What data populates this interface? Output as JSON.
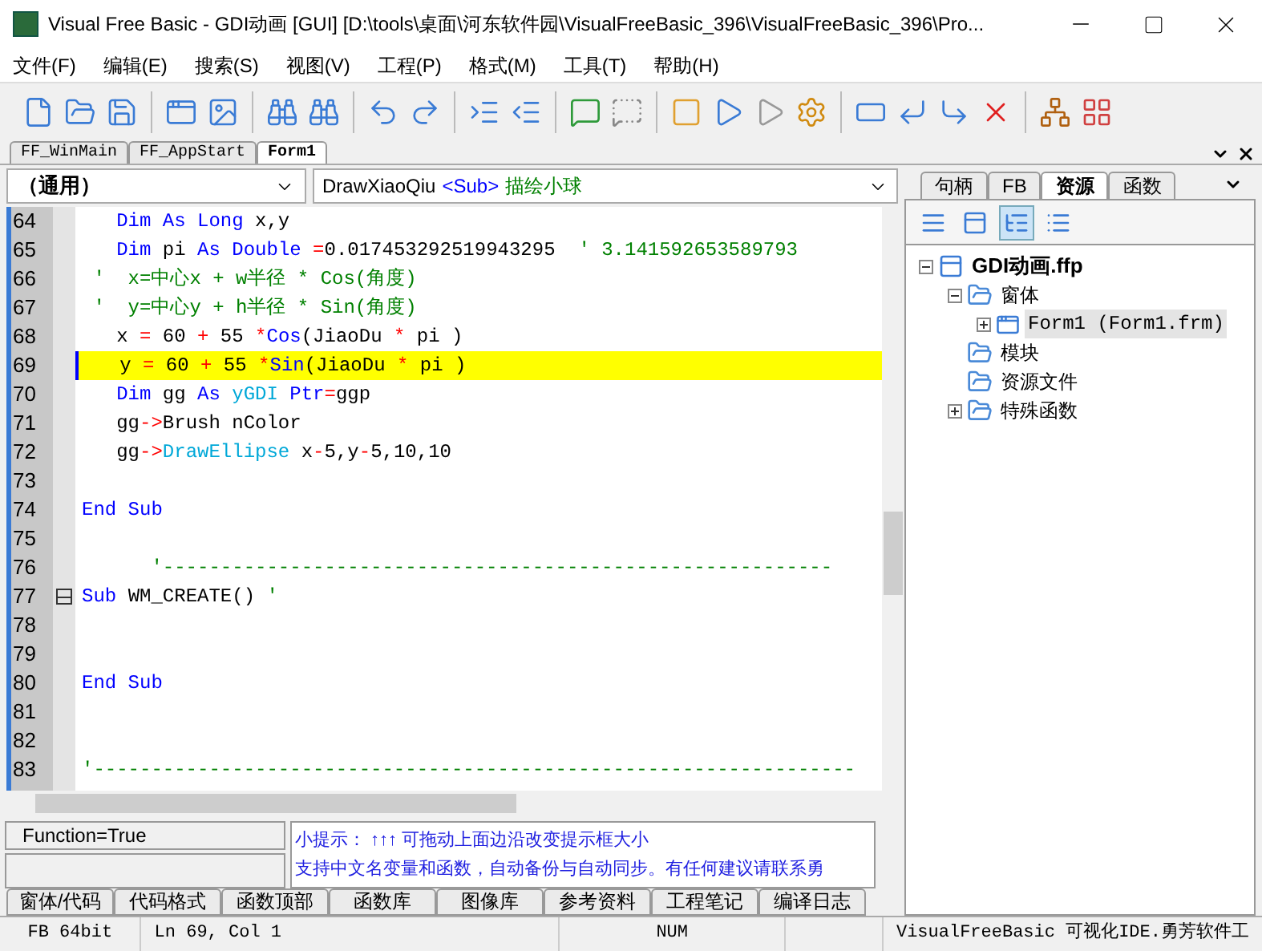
{
  "window": {
    "title": "Visual Free Basic - GDI动画 [GUI]  [D:\\tools\\桌面\\河东软件园\\VisualFreeBasic_396\\VisualFreeBasic_396\\Pro..."
  },
  "menu": [
    "文件(F)",
    "编辑(E)",
    "搜索(S)",
    "视图(V)",
    "工程(P)",
    "格式(M)",
    "工具(T)",
    "帮助(H)"
  ],
  "file_tabs": [
    {
      "label": "FF_WinMain",
      "selected": false
    },
    {
      "label": "FF_AppStart",
      "selected": false
    },
    {
      "label": "Form1",
      "selected": true
    }
  ],
  "object_combo": {
    "value": "（通用）"
  },
  "proc_combo": {
    "name": "DrawXiaoQiu",
    "kind_label": "<Sub>",
    "description": "描绘小球"
  },
  "code_lines": [
    {
      "number": "64",
      "selected": false,
      "tokens": [
        {
          "text": "   Dim As Long ",
          "kind": "kw"
        },
        {
          "text": "x,y",
          "kind": "tx"
        }
      ]
    },
    {
      "number": "65",
      "selected": false,
      "tokens": [
        {
          "text": "   Dim ",
          "kind": "kw"
        },
        {
          "text": "pi ",
          "kind": "tx"
        },
        {
          "text": "As Double ",
          "kind": "kw"
        },
        {
          "text": "=",
          "kind": "op"
        },
        {
          "text": "0.017453292519943295  ",
          "kind": "tx"
        },
        {
          "text": "' 3.141592653589793",
          "kind": "cm"
        }
      ]
    },
    {
      "number": "66",
      "selected": false,
      "tokens": [
        {
          "text": " '  x=中心x + w半径 * Cos(角度)",
          "kind": "cm"
        }
      ]
    },
    {
      "number": "67",
      "selected": false,
      "tokens": [
        {
          "text": " '  y=中心y + h半径 * Sin(角度)",
          "kind": "cm"
        }
      ]
    },
    {
      "number": "68",
      "selected": false,
      "tokens": [
        {
          "text": "   x ",
          "kind": "tx"
        },
        {
          "text": "=",
          "kind": "op"
        },
        {
          "text": " 60 ",
          "kind": "tx"
        },
        {
          "text": "+",
          "kind": "op"
        },
        {
          "text": " 55 ",
          "kind": "tx"
        },
        {
          "text": "*",
          "kind": "op"
        },
        {
          "text": "Cos",
          "kind": "kw"
        },
        {
          "text": "(JiaoDu ",
          "kind": "tx"
        },
        {
          "text": "*",
          "kind": "op"
        },
        {
          "text": " pi )",
          "kind": "tx"
        }
      ]
    },
    {
      "number": "69",
      "selected": true,
      "tokens": [
        {
          "text": "   y ",
          "kind": "tx"
        },
        {
          "text": "=",
          "kind": "op"
        },
        {
          "text": " 60 ",
          "kind": "tx"
        },
        {
          "text": "+",
          "kind": "op"
        },
        {
          "text": " 55 ",
          "kind": "tx"
        },
        {
          "text": "*",
          "kind": "op"
        },
        {
          "text": "Sin",
          "kind": "kw"
        },
        {
          "text": "(JiaoDu ",
          "kind": "tx"
        },
        {
          "text": "*",
          "kind": "op"
        },
        {
          "text": " pi )",
          "kind": "tx"
        }
      ]
    },
    {
      "number": "70",
      "selected": false,
      "tokens": [
        {
          "text": "   Dim ",
          "kind": "kw"
        },
        {
          "text": "gg ",
          "kind": "tx"
        },
        {
          "text": "As ",
          "kind": "kw"
        },
        {
          "text": "yGDI ",
          "kind": "ty"
        },
        {
          "text": "Ptr",
          "kind": "kw"
        },
        {
          "text": "=",
          "kind": "op"
        },
        {
          "text": "ggp",
          "kind": "tx"
        }
      ]
    },
    {
      "number": "71",
      "selected": false,
      "tokens": [
        {
          "text": "   gg",
          "kind": "tx"
        },
        {
          "text": "->",
          "kind": "op"
        },
        {
          "text": "Brush nColor",
          "kind": "tx"
        }
      ]
    },
    {
      "number": "72",
      "selected": false,
      "tokens": [
        {
          "text": "   gg",
          "kind": "tx"
        },
        {
          "text": "->",
          "kind": "op"
        },
        {
          "text": "DrawEllipse ",
          "kind": "ty"
        },
        {
          "text": "x",
          "kind": "tx"
        },
        {
          "text": "-",
          "kind": "op"
        },
        {
          "text": "5,y",
          "kind": "tx"
        },
        {
          "text": "-",
          "kind": "op"
        },
        {
          "text": "5,10,10",
          "kind": "tx"
        }
      ]
    },
    {
      "number": "73",
      "selected": false
    },
    {
      "number": "74",
      "selected": false,
      "tokens": [
        {
          "text": "End Sub",
          "kind": "kw"
        }
      ]
    },
    {
      "number": "75",
      "selected": false
    },
    {
      "number": "76",
      "selected": false,
      "tokens": [
        {
          "text": "      '----------------------------------------------------------",
          "kind": "cm"
        }
      ]
    },
    {
      "number": "77",
      "selected": false,
      "fold": true,
      "tokens": [
        {
          "text": "Sub ",
          "kind": "kw"
        },
        {
          "text": "WM_CREATE() ",
          "kind": "tx"
        },
        {
          "text": "'",
          "kind": "cm"
        }
      ]
    },
    {
      "number": "78",
      "selected": false
    },
    {
      "number": "79",
      "selected": false
    },
    {
      "number": "80",
      "selected": false,
      "tokens": [
        {
          "text": "End Sub",
          "kind": "kw"
        }
      ]
    },
    {
      "number": "81",
      "selected": false
    },
    {
      "number": "82",
      "selected": false
    },
    {
      "number": "83",
      "selected": false,
      "tokens": [
        {
          "text": "'------------------------------------------------------------------",
          "kind": "cm"
        }
      ]
    }
  ],
  "info_box": {
    "line_1": "Function=True"
  },
  "hint": {
    "lines": [
      "小提示： ↑↑↑ 可拖动上面边沿改变提示框大小",
      "支持中文名变量和函数，自动备份与自动同步。有任何建议请联系勇"
    ]
  },
  "bottom_tabs": [
    {
      "label": "窗体/代码",
      "selected": false
    },
    {
      "label": "代码格式",
      "selected": false
    },
    {
      "label": "函数顶部",
      "selected": false
    },
    {
      "label": "函数库",
      "selected": false
    },
    {
      "label": "图像库",
      "selected": false
    },
    {
      "label": "参考资料",
      "selected": false
    },
    {
      "label": "工程笔记",
      "selected": false
    },
    {
      "label": "编译日志",
      "selected": false
    }
  ],
  "side_tabs": [
    {
      "label": "句柄",
      "selected": false
    },
    {
      "label": "FB",
      "selected": false
    },
    {
      "label": "资源",
      "selected": true
    },
    {
      "label": "函数",
      "selected": false
    }
  ],
  "side_toolbar": [
    {
      "selected": false
    },
    {
      "selected": false
    },
    {
      "selected": true
    },
    {
      "selected": false
    }
  ],
  "tree": [
    {
      "label": "GDI动画.ffp",
      "kind": "project",
      "expanded": true,
      "selected": false,
      "children": [
        {
          "label": "窗体",
          "kind": "folder",
          "expanded": true,
          "selected": false,
          "children": [
            {
              "label": "Form1 (Form1.frm)",
              "kind": "form",
              "expanded": false,
              "selected": true
            }
          ]
        },
        {
          "label": "模块",
          "kind": "folder",
          "selected": false
        },
        {
          "label": "资源文件",
          "kind": "folder",
          "selected": false
        },
        {
          "label": "特殊函数",
          "kind": "folder",
          "expanded": false,
          "selected": false
        }
      ]
    }
  ],
  "status_bar": [
    "FB 64bit",
    "Ln 69,  Col 1",
    "NUM",
    "VisualFreeBasic 可视化IDE.勇芳软件工"
  ]
}
